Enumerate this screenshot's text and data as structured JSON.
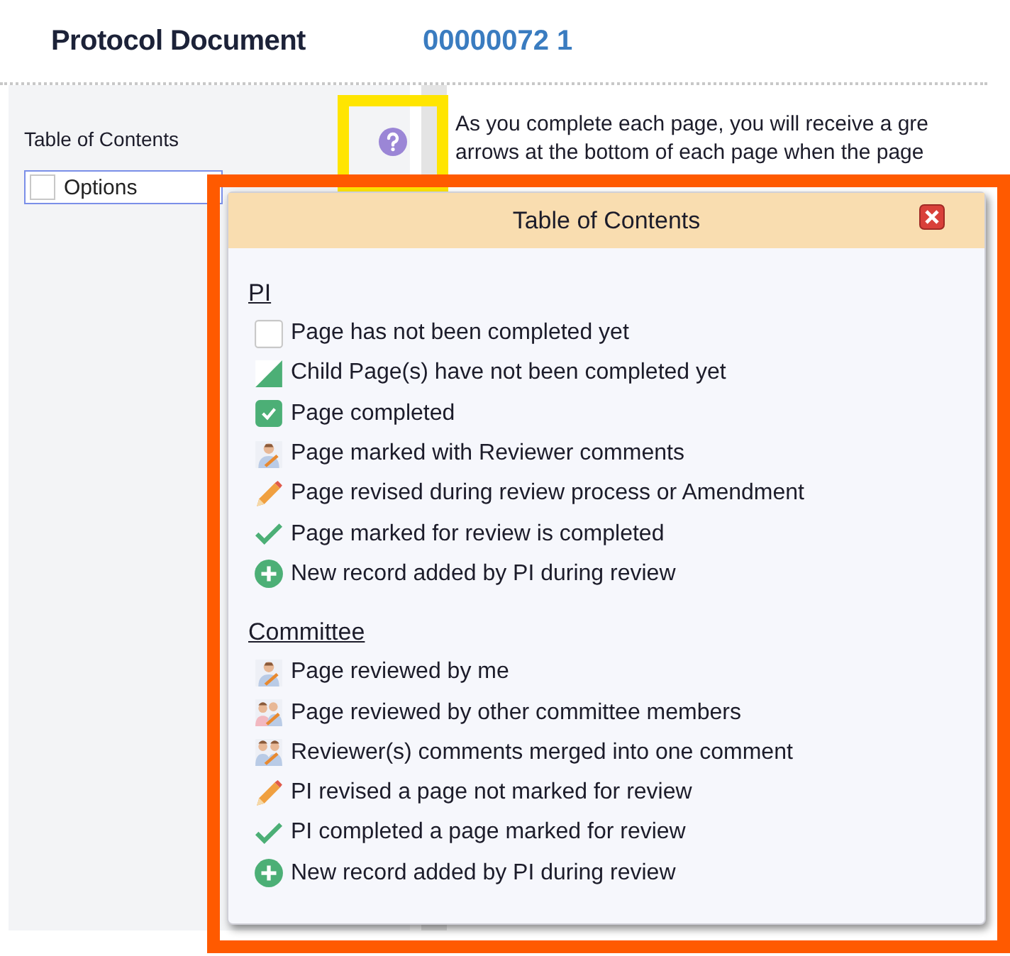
{
  "header": {
    "title": "Protocol Document",
    "number": "00000072 1"
  },
  "sidebar": {
    "heading": "Table of Contents",
    "options_button": {
      "label": "Options",
      "checked": false
    }
  },
  "intro_lines": [
    "As you complete each page, you will receive a gre",
    "arrows at the bottom of each page when the page"
  ],
  "help_highlighted": true,
  "dialog": {
    "title": "Table of Contents",
    "highlighted": true,
    "sections": [
      {
        "heading": "PI",
        "items": [
          {
            "kind": "empty",
            "text": "Page has not been completed yet"
          },
          {
            "kind": "partial",
            "text": "Child Page(s) have not been completed yet"
          },
          {
            "kind": "complete",
            "text": "Page completed"
          },
          {
            "kind": "reviewer",
            "text": "Page marked with Reviewer comments"
          },
          {
            "kind": "pencil",
            "text": "Page revised during review process or Amendment"
          },
          {
            "kind": "check",
            "text": "Page marked for review is completed"
          },
          {
            "kind": "plus",
            "text": "New record added by PI during review"
          }
        ]
      },
      {
        "heading": "Committee",
        "items": [
          {
            "kind": "reviewer",
            "text": "Page reviewed by me"
          },
          {
            "kind": "others",
            "text": "Page reviewed by other committee members"
          },
          {
            "kind": "merged",
            "text": "Reviewer(s) comments merged into one comment"
          },
          {
            "kind": "pencil",
            "text": "PI revised a page not marked for review"
          },
          {
            "kind": "check",
            "text": "PI completed a page marked for review"
          },
          {
            "kind": "plus",
            "text": "New record added by PI during review"
          }
        ]
      }
    ]
  }
}
